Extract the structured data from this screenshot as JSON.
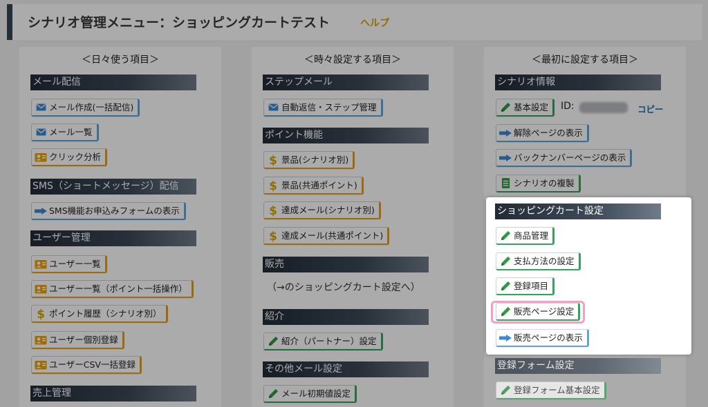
{
  "header": {
    "title": "シナリオ管理メニュー：ショッピングカートテスト",
    "help": "ヘルプ"
  },
  "columns": [
    {
      "heading": "＜日々使う項目＞",
      "sections": [
        "メール配信",
        "SMS（ショートメッセージ）配信",
        "ユーザー管理",
        "売上管理"
      ],
      "buttons": [
        "メール作成(一括配信)",
        "メール一覧",
        "クリック分析",
        "SMS機能お申込みフォームの表示",
        "ユーザー一覧",
        "ユーザー一覧（ポイント一括操作）",
        "ポイント履歴（シナリオ別）",
        "ユーザー個別登録",
        "ユーザーCSV一括登録"
      ]
    },
    {
      "heading": "＜時々設定する項目＞",
      "sections": [
        "ステップメール",
        "ポイント機能",
        "販売",
        "紹介",
        "その他メール設定"
      ],
      "buttons": [
        "自動返信・ステップ管理",
        "景品(シナリオ別)",
        "景品(共通ポイント)",
        "達成メール(シナリオ別)",
        "達成メール(共通ポイント)",
        "紹介（パートナー）設定",
        "メール初期値設定"
      ],
      "note": "（→のショッピングカート設定へ）"
    },
    {
      "heading": "＜最初に設定する項目＞",
      "sections": [
        "シナリオ情報",
        "ショッピングカート設定",
        "登録フォーム設定"
      ],
      "buttons": [
        "基本設定",
        "解除ページの表示",
        "バックナンバーページの表示",
        "シナリオの複製",
        "商品管理",
        "支払方法の設定",
        "登録項目",
        "販売ページ設定",
        "販売ページの表示",
        "登録フォーム基本設定"
      ],
      "id_label": "ID:",
      "copy": "コピー"
    }
  ],
  "colors": {
    "section_bar": "#222c38",
    "blue": "#5ba6de",
    "orange": "#e89d16",
    "green": "#34a45a",
    "help": "#d9a400",
    "highlight": "#f2a0c8"
  },
  "icons": {
    "mail": "envelope-icon",
    "arrow": "arrow-right-icon",
    "user": "user-card-icon",
    "dollar": "dollar-icon",
    "pencil": "pencil-icon",
    "copy": "document-copy-icon"
  }
}
